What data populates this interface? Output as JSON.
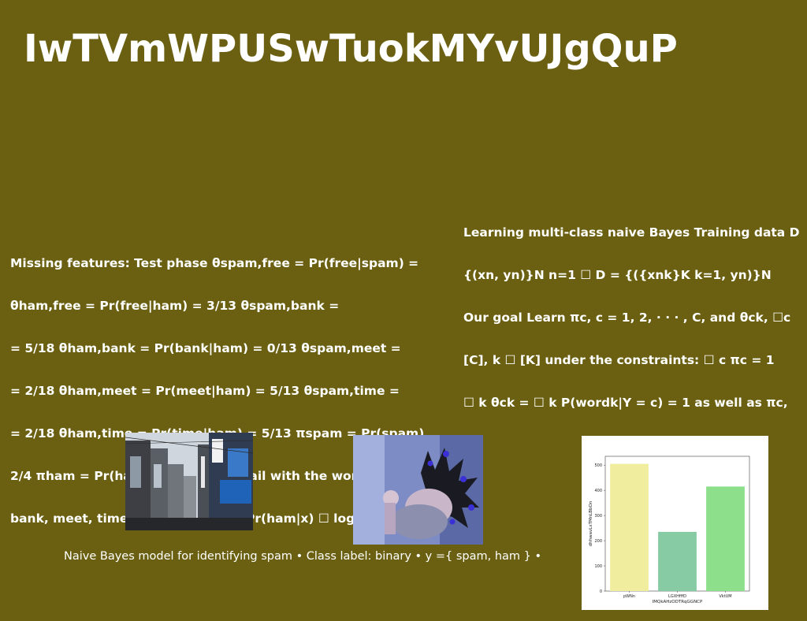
{
  "page": {
    "title": "IwTVmWPUSwTuokMYvUJgQuP",
    "background": "#6b6011"
  },
  "left_paragraph": {
    "lines": [
      "Missing features: Test phase θspam,free = Pr(free|spam) =",
      "θham,free = Pr(free|ham) = 3/13 θspam,bank =",
      "= 5/18 θham,bank = Pr(bank|ham) = 0/13 θspam,meet =",
      "= 2/18 θham,meet = Pr(meet|ham) = 5/13 θspam,time =",
      "= 2/18 θham,time = Pr(time|ham) = 5/13 πspam = Pr(spam)",
      "2/4 πham = Pr(ham) = 2/4 New email with the word counts",
      "bank, meet, time) = (1,3,4,2), log Pr(ham|x) ☐ log Pr(ham) ·"
    ]
  },
  "right_paragraph": {
    "lines": [
      "Learning multi-class naive Bayes Training data D",
      "{(xn, yn)}N n=1 ☐ D = {({xnk}K k=1, yn)}N",
      "Our goal Learn πc, c = 1, 2, · · · , C, and θck, ☐c",
      "[C], k ☐ [K] under the constraints: ☐ c πc = 1",
      "☐ k θck = ☐ k P(wordk|Y = c) = 1 as well as πc,"
    ]
  },
  "images": {
    "street_photo": "street-photo",
    "boy_photo": "boy-with-crown-photo"
  },
  "caption": "Naive Bayes model for identifying spam • Class label: binary • y ={ spam, ham } •",
  "chart_data": {
    "type": "bar",
    "categories": [
      "pWNn",
      "LGXHfffD",
      "VktUM"
    ],
    "values": [
      505,
      235,
      415
    ],
    "colors": [
      "#f0ee9e",
      "#86cba4",
      "#8ddf8c"
    ],
    "xlabel": "IMQkAHzODTRqGGNCP",
    "ylabel": "dhhwavLxTMnLBbOn",
    "ylim": [
      0,
      535
    ],
    "yticks": [
      0,
      100,
      200,
      300,
      400,
      500
    ],
    "grid": false
  }
}
